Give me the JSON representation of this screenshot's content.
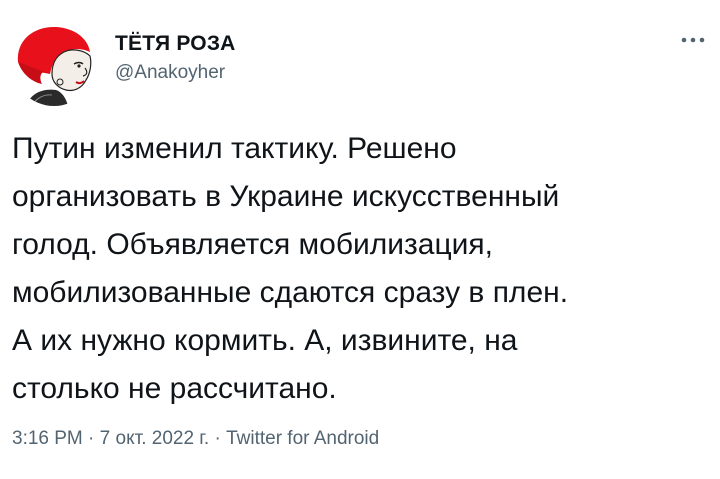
{
  "tweet": {
    "display_name": "ТЁТЯ РОЗА",
    "handle": "@Anakoyher",
    "more_icon": "more-horizontal-icon",
    "text": "Путин изменил тактику. Решено\nорганизовать в Украине искусственный\nголод. Объявляется мобилизация,\nмобилизованные сдаются сразу в плен.\nА их нужно кормить. А, извините, на\nстолько не рассчитано.",
    "time": "3:16 PM",
    "separator": " · ",
    "date": "7 окт. 2022 г.",
    "source": "Twitter for Android",
    "colors": {
      "text": "#0f1419",
      "secondary": "#536471",
      "avatar_accent": "#e8111b"
    }
  }
}
